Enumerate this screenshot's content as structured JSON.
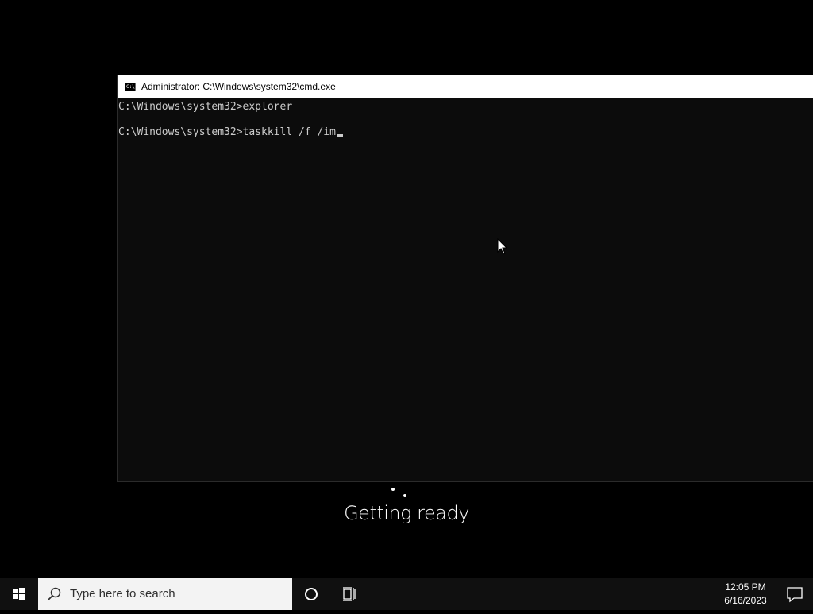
{
  "console": {
    "title": "Administrator: C:\\Windows\\system32\\cmd.exe",
    "lines": [
      "C:\\Windows\\system32>explorer",
      "",
      "C:\\Windows\\system32>taskkill /f /im"
    ],
    "text_color": "#cccccc",
    "background": "#0c0c0c"
  },
  "overlay": {
    "status_text": "Getting ready"
  },
  "taskbar": {
    "start_icon": "windows-logo-icon",
    "search_placeholder": "Type here to search",
    "search_icon": "search-icon",
    "cortana_icon": "cortana-circle-icon",
    "taskview_icon": "task-view-icon",
    "notification_icon": "action-center-icon",
    "clock": {
      "time": "12:05 PM",
      "date": "6/16/2023"
    },
    "background": "#101010"
  },
  "desktop": {
    "background": "#000000"
  }
}
